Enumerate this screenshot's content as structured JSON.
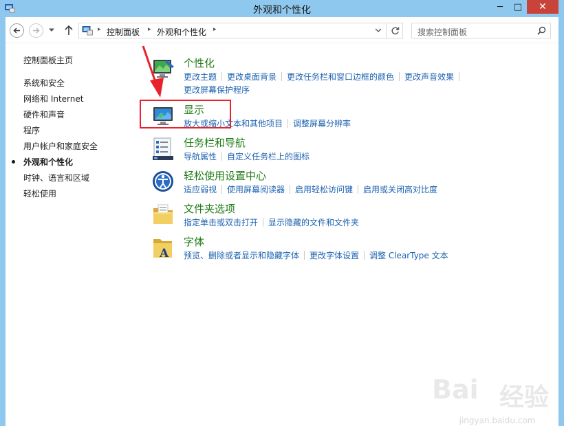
{
  "window": {
    "title": "外观和个性化",
    "minimize": "─",
    "maximize": "□",
    "close": "✕"
  },
  "address": {
    "crumbs": [
      "控制面板",
      "外观和个性化"
    ]
  },
  "search": {
    "placeholder": "搜索控制面板"
  },
  "sidebar": {
    "items": [
      {
        "label": "控制面板主页"
      },
      {
        "label": "系统和安全"
      },
      {
        "label": "网络和 Internet"
      },
      {
        "label": "硬件和声音"
      },
      {
        "label": "程序"
      },
      {
        "label": "用户帐户和家庭安全"
      },
      {
        "label": "外观和个性化",
        "current": true
      },
      {
        "label": "时钟、语言和区域"
      },
      {
        "label": "轻松使用"
      }
    ]
  },
  "categories": [
    {
      "title": "个性化",
      "icon": "personalization-icon",
      "links": [
        "更改主题",
        "更改桌面背景",
        "更改任务栏和窗口边框的颜色",
        "更改声音效果",
        "更改屏幕保护程序"
      ]
    },
    {
      "title": "显示",
      "icon": "display-icon",
      "links": [
        "放大或缩小文本和其他项目",
        "调整屏幕分辨率"
      ]
    },
    {
      "title": "任务栏和导航",
      "icon": "taskbar-icon",
      "links": [
        "导航属性",
        "自定义任务栏上的图标"
      ]
    },
    {
      "title": "轻松使用设置中心",
      "icon": "ease-of-access-icon",
      "links": [
        "适应弱视",
        "使用屏幕阅读器",
        "启用轻松访问键",
        "启用或关闭高对比度"
      ]
    },
    {
      "title": "文件夹选项",
      "icon": "folder-options-icon",
      "links": [
        "指定单击或双击打开",
        "显示隐藏的文件和文件夹"
      ]
    },
    {
      "title": "字体",
      "icon": "fonts-icon",
      "links": [
        "预览、删除或者显示和隐藏字体",
        "更改字体设置",
        "调整 ClearType 文本"
      ]
    }
  ],
  "watermark": {
    "logo": "Bai",
    "text": "经验",
    "url": "jingyan.baidu.com"
  },
  "colors": {
    "title_bar": "#8fc8ee",
    "category_title": "#1e7a14",
    "link": "#1c62b0",
    "annotation": "#e8222d"
  }
}
